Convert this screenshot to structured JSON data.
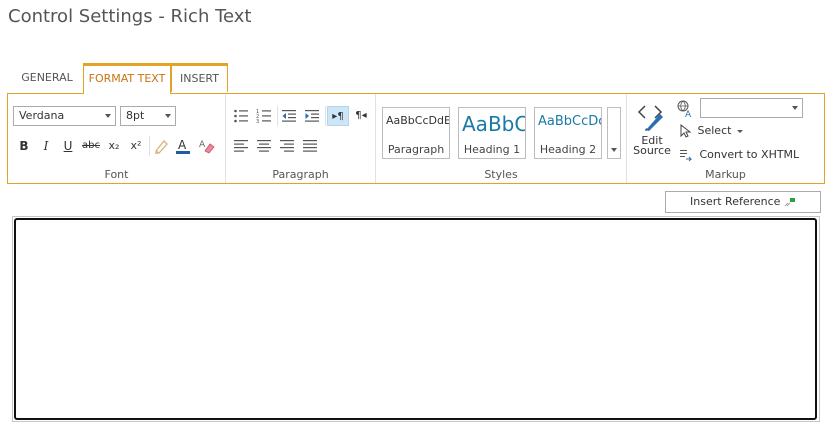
{
  "title": "Control Settings - Rich Text",
  "tabs": [
    {
      "label": "GENERAL"
    },
    {
      "label": "FORMAT TEXT"
    },
    {
      "label": "INSERT"
    }
  ],
  "font_group": {
    "font_name": "Verdana",
    "font_size": "8pt",
    "label": "Font",
    "bold": "B",
    "italic": "I",
    "underline": "U",
    "strike": "abc",
    "subscript": "x₂",
    "superscript": "x²"
  },
  "paragraph_group": {
    "label": "Paragraph"
  },
  "styles_group": {
    "label": "Styles",
    "tiles": [
      {
        "sample": "AaBbCcDdEe",
        "name": "Paragraph"
      },
      {
        "sample": "AaBbC",
        "name": "Heading 1"
      },
      {
        "sample": "AaBbCcDc",
        "name": "Heading 2"
      }
    ]
  },
  "markup_group": {
    "label": "Markup",
    "edit_source": "Edit Source",
    "edit_source_line1": "Edit",
    "edit_source_line2": "Source",
    "select": "Select",
    "convert": "Convert to XHTML",
    "language_value": ""
  },
  "insert_reference": "Insert Reference",
  "colors": {
    "accent": "#e4a326",
    "active_text": "#c77411",
    "style_blue": "#1a7aa6"
  }
}
